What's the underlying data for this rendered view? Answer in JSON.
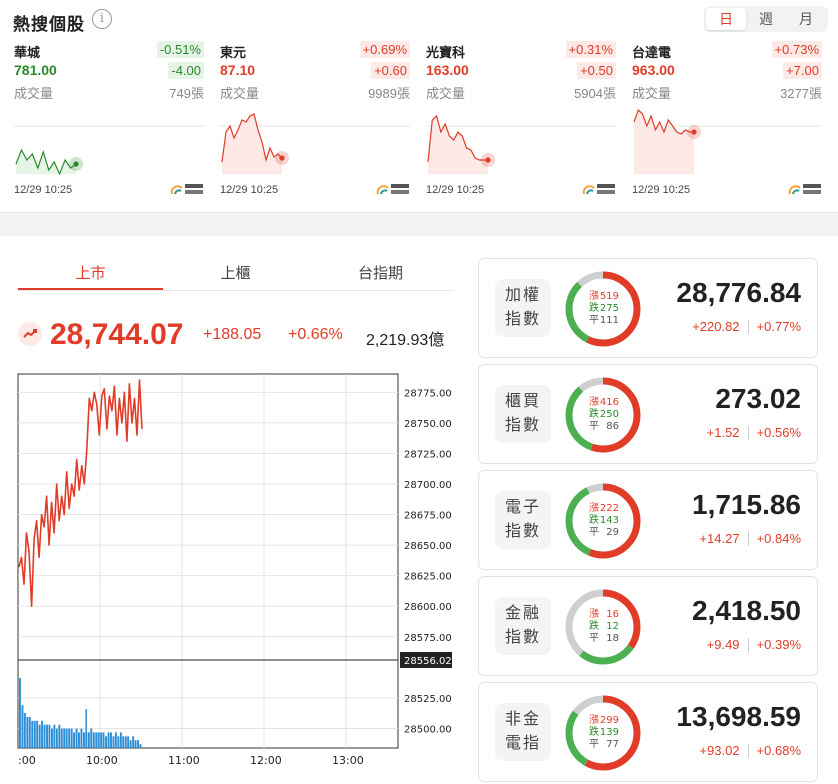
{
  "hot": {
    "title": "熱搜個股",
    "info_icon": "info-icon",
    "periods": [
      "日",
      "週",
      "月"
    ],
    "active_period": 0,
    "stocks": [
      {
        "name": "華城",
        "pct": "-0.51%",
        "price": "781.00",
        "change": "-4.00",
        "vol_label": "成交量",
        "volume": "749張",
        "time": "12/29 10:25",
        "dir": "dn",
        "series": [
          62,
          48,
          58,
          52,
          66,
          50,
          68,
          60,
          72,
          58,
          66,
          62
        ]
      },
      {
        "name": "東元",
        "pct": "+0.69%",
        "price": "87.10",
        "change": "+0.60",
        "vol_label": "成交量",
        "volume": "9989張",
        "time": "12/29 10:25",
        "dir": "up",
        "series": [
          60,
          30,
          24,
          36,
          28,
          18,
          20,
          14,
          12,
          28,
          40,
          58,
          46,
          55,
          52,
          56
        ]
      },
      {
        "name": "光寶科",
        "pct": "+0.31%",
        "price": "163.00",
        "change": "+0.50",
        "vol_label": "成交量",
        "volume": "5904張",
        "time": "12/29 10:25",
        "dir": "up",
        "series": [
          60,
          18,
          14,
          30,
          22,
          34,
          38,
          30,
          34,
          46,
          48,
          56,
          58,
          58,
          58
        ]
      },
      {
        "name": "台達電",
        "pct": "+0.73%",
        "price": "963.00",
        "change": "+7.00",
        "vol_label": "成交量",
        "volume": "3277張",
        "time": "12/29 10:25",
        "dir": "up",
        "series": [
          20,
          8,
          12,
          24,
          14,
          28,
          20,
          30,
          18,
          24,
          30,
          32,
          28,
          30,
          30
        ]
      }
    ]
  },
  "market": {
    "tabs": [
      "上市",
      "上櫃",
      "台指期"
    ],
    "active_tab": 0,
    "trend_icon": "trend-up-icon",
    "value": "28,744.07",
    "change": "+188.05",
    "pct": "+0.66%",
    "amount": "2,219.93億"
  },
  "chart_data": {
    "type": "line",
    "title": "",
    "xlabel": "",
    "ylabel": "",
    "x_ticks": [
      ":00",
      "10:00",
      "11:00",
      "12:00",
      "13:00"
    ],
    "y_ticks": [
      "28775.00",
      "28750.00",
      "28725.00",
      "28700.00",
      "28675.00",
      "28650.00",
      "28625.00",
      "28600.00",
      "28575.00",
      "28525.00",
      "28500.00"
    ],
    "ylim": [
      28484,
      28790
    ],
    "reference_label": "28556.02",
    "reference_value": 28556.02,
    "series": [
      {
        "values": [
          28632,
          28640,
          28618,
          28660,
          28645,
          28600,
          28655,
          28670,
          28640,
          28675,
          28665,
          28690,
          28650,
          28685,
          28660,
          28700,
          28670,
          28690,
          28675,
          28710,
          28680,
          28700,
          28690,
          28720,
          28695,
          28715,
          28700,
          28728,
          28770,
          28760,
          28775,
          28765,
          28740,
          28772,
          28778,
          28745,
          28772,
          28760,
          28780,
          28740,
          28770,
          28750,
          28775,
          28735,
          28782,
          28750,
          28770,
          28740,
          28785,
          28745
        ]
      }
    ],
    "volume": [
      18,
      11,
      9,
      8,
      8,
      7,
      7,
      7,
      6,
      7,
      6,
      6,
      6,
      5,
      6,
      5,
      6,
      5,
      5,
      5,
      5,
      5,
      4,
      5,
      4,
      5,
      4,
      4,
      4,
      5,
      4,
      4,
      4,
      4,
      4,
      3,
      4,
      4,
      3,
      4,
      3,
      4,
      3,
      3,
      3,
      2,
      3,
      2,
      2,
      1
    ],
    "volume_spike_index": 27,
    "volume_spike_value": 10,
    "grid": true
  },
  "indices": [
    {
      "label_line1": "加權",
      "label_line2": "指數",
      "up_label": "漲",
      "up": 519,
      "dn_label": "跌",
      "dn": 275,
      "flat_label": "平",
      "flat": 111,
      "value": "28,776.84",
      "change": "+220.82",
      "pct": "+0.77%"
    },
    {
      "label_line1": "櫃買",
      "label_line2": "指數",
      "up_label": "漲",
      "up": 416,
      "dn_label": "跌",
      "dn": 250,
      "flat_label": "平",
      "flat": 86,
      "value": "273.02",
      "change": "+1.52",
      "pct": "+0.56%"
    },
    {
      "label_line1": "電子",
      "label_line2": "指數",
      "up_label": "漲",
      "up": 222,
      "dn_label": "跌",
      "dn": 143,
      "flat_label": "平",
      "flat": 29,
      "value": "1,715.86",
      "change": "+14.27",
      "pct": "+0.84%"
    },
    {
      "label_line1": "金融",
      "label_line2": "指數",
      "up_label": "漲",
      "up": 16,
      "dn_label": "跌",
      "dn": 12,
      "flat_label": "平",
      "flat": 18,
      "value": "2,418.50",
      "change": "+9.49",
      "pct": "+0.39%"
    },
    {
      "label_line1": "非金",
      "label_line2": "電指",
      "up_label": "漲",
      "up": 299,
      "dn_label": "跌",
      "dn": 139,
      "flat_label": "平",
      "flat": 77,
      "value": "13,698.59",
      "change": "+93.02",
      "pct": "+0.68%"
    }
  ],
  "colors": {
    "up": "#e03c28",
    "down": "#2a8a2a",
    "flat": "#cfcfcf",
    "volume": "#2b8dd6"
  }
}
